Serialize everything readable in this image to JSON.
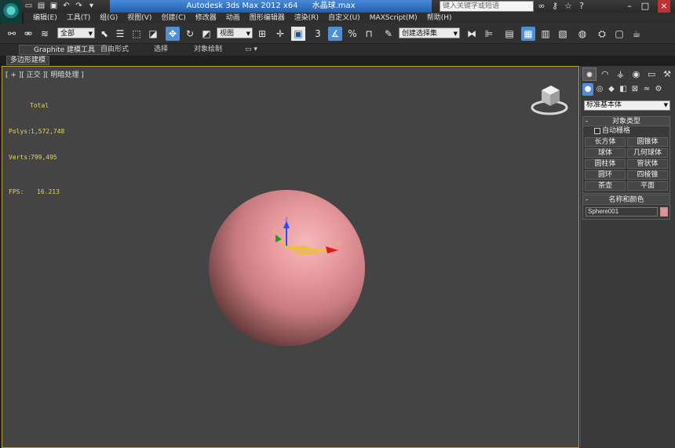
{
  "title_bar": {
    "app_title": "Autodesk 3ds Max  2012 x64",
    "file_name": "水晶球.max",
    "search_placeholder": "键入关键字或短语",
    "quick_access": [
      "new-file-icon",
      "open-file-icon",
      "save-icon",
      "undo-icon",
      "redo-icon",
      "customize-qat-icon"
    ],
    "right_icons": [
      "binoculars-icon",
      "key-icon",
      "star-icon",
      "help-icon"
    ],
    "window_buttons": [
      "minimize-icon",
      "maximize-icon",
      "close-icon"
    ]
  },
  "menu": [
    "编辑(E)",
    "工具(T)",
    "组(G)",
    "视图(V)",
    "创建(C)",
    "修改器",
    "动画",
    "图形编辑器",
    "渲染(R)",
    "自定义(U)",
    "MAXScript(M)",
    "帮助(H)"
  ],
  "toolbar": {
    "selection_filter": "全部",
    "reference_coord": "视图",
    "named_selection": "创建选择集",
    "snap_label": "3"
  },
  "ribbon": {
    "tabs": [
      "Graphite 建模工具",
      "自由形式",
      "选择",
      "对象绘制"
    ],
    "active_subtab": "多边形建模"
  },
  "viewport": {
    "label": "[ + ][ 正交 ][ 明暗处理 ]",
    "stats_header": "Total",
    "stats": [
      {
        "key": "Polys:",
        "value": "1,572,748"
      },
      {
        "key": "Verts:",
        "value": "799,495"
      }
    ],
    "fps_key": "FPS:",
    "fps_value": "16.213",
    "gizmo_axes": {
      "x": "x",
      "y": "y",
      "z": "z"
    },
    "sphere_color": "#e79a9d"
  },
  "command_panel": {
    "category": "标准基本体",
    "object_type": {
      "title": "对象类型",
      "autogrid": "自动栅格",
      "buttons": [
        "长方体",
        "圆锥体",
        "球体",
        "几何球体",
        "圆柱体",
        "管状体",
        "圆环",
        "四棱锥",
        "茶壶",
        "平面"
      ]
    },
    "name_color": {
      "title": "名称和颜色",
      "name_value": "Sphere001",
      "object_color": "#e88f8f"
    }
  }
}
